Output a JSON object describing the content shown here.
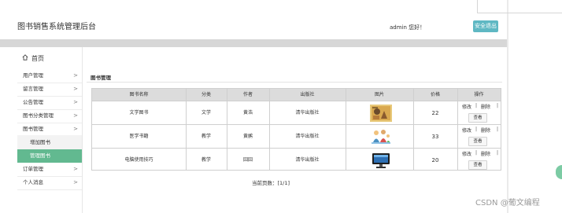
{
  "header": {
    "app_title": "图书销售系统管理后台",
    "greeting": "admin 您好！",
    "logout_label": "安全退出"
  },
  "sidebar": {
    "home_label": "首页",
    "home_icon": "home-icon",
    "arrow_glyph": ">",
    "items": [
      {
        "label": "用户管理"
      },
      {
        "label": "留言管理"
      },
      {
        "label": "公告管理"
      },
      {
        "label": "图书分类管理"
      },
      {
        "label": "图书管理"
      },
      {
        "label": "订单管理"
      },
      {
        "label": "个人消息"
      }
    ],
    "subitems": [
      {
        "label": "增加图书",
        "active": false
      },
      {
        "label": "管理图书",
        "active": true
      }
    ]
  },
  "main": {
    "section_title": "图书管理",
    "table": {
      "headers": [
        "图书名称",
        "分类",
        "作者",
        "出版社",
        "图片",
        "价格",
        "操作"
      ],
      "rows": [
        {
          "name": "文学图书",
          "category": "文学",
          "author": "黄浩",
          "publisher": "清华出版社",
          "image": "book-cover",
          "price": "22"
        },
        {
          "name": "医学书籍",
          "category": "教学",
          "author": "黄鹂",
          "publisher": "清华出版社",
          "image": "family-illustration",
          "price": "33"
        },
        {
          "name": "电脑使用技巧",
          "category": "教学",
          "author": "囧囧",
          "publisher": "清华出版社",
          "image": "computer-monitor",
          "price": "20"
        }
      ],
      "actions": {
        "edit": "修改",
        "delete": "删除",
        "view": "查看",
        "separator": "|"
      }
    },
    "pager": "当前页数：[1/1]"
  },
  "watermark": "CSDN @葡文编程",
  "colors": {
    "logout_bg": "#5fb8c3",
    "active_menu_bg": "#62b990",
    "header_bar": "#d7d7d7",
    "table_header_bg": "#dcdcdc"
  }
}
